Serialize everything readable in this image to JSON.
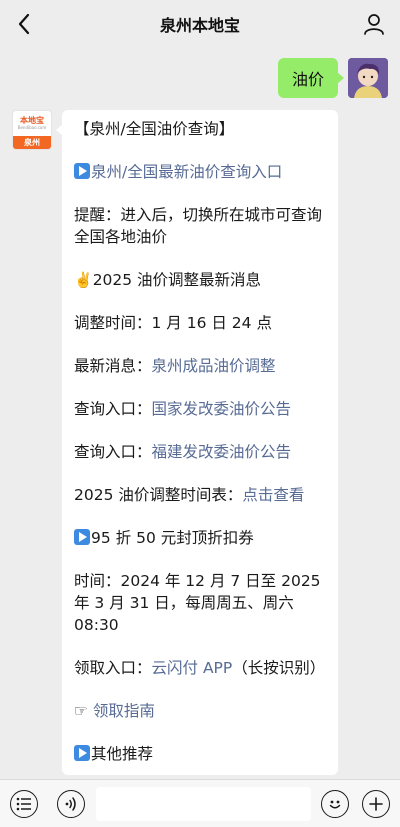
{
  "header": {
    "title": "泉州本地宝",
    "back_icon": "chevron-left-icon",
    "profile_icon": "person-icon"
  },
  "user_message": {
    "text": "油价"
  },
  "bot": {
    "logo_text": "本地宝",
    "logo_sub": "Bendibao.com",
    "city": "泉州"
  },
  "reply": {
    "title": "【泉州/全国油价查询】",
    "entry_link": "泉州/全国最新油价查询入口",
    "reminder": "提醒：进入后，切换所在城市可查询全国各地油价",
    "latest_heading": "2025 油价调整最新消息",
    "adjust_time": "调整时间：1 月 16 日 24 点",
    "latest_news_label": "最新消息：",
    "latest_news_link": "泉州成品油价调整",
    "query1_label": "查询入口：",
    "query1_link": "国家发改委油价公告",
    "query2_label": "查询入口：",
    "query2_link": "福建发改委油价公告",
    "schedule_label": "2025 油价调整时间表：",
    "schedule_link": "点击查看",
    "coupon": "95 折 50 元封顶折扣券",
    "time_text": "时间：2024 年 12 月 7 日至 2025 年 3 月 31 日，每周周五、周六 08:30",
    "get_label": "领取入口：",
    "get_link": "云闪付 APP",
    "get_suffix": "（长按识别）",
    "guide_link": "领取指南",
    "others": "其他推荐"
  },
  "bottom": {
    "menu_icon": "menu-list-icon",
    "voice_icon": "voice-icon",
    "emoji_icon": "emoji-icon",
    "plus_icon": "plus-icon"
  },
  "colors": {
    "link": "#576b95",
    "user_bubble": "#95ec69",
    "background": "#ededed",
    "brand_orange": "#f26722"
  }
}
